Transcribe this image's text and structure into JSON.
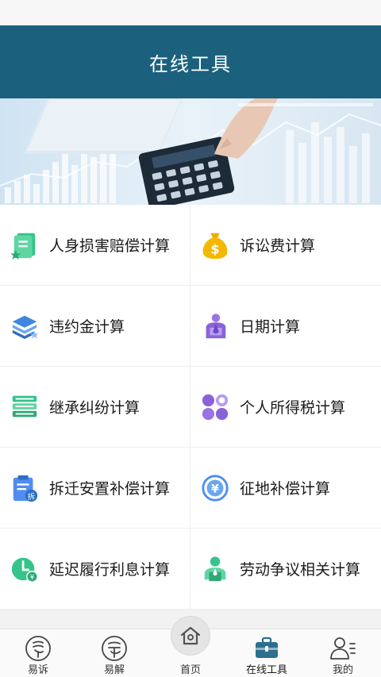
{
  "header": {
    "title": "在线工具"
  },
  "tools": [
    {
      "label": "人身损害赔偿计算",
      "icon": "notebook-icon"
    },
    {
      "label": "诉讼费计算",
      "icon": "money-bag-icon"
    },
    {
      "label": "违约金计算",
      "icon": "layers-icon"
    },
    {
      "label": "日期计算",
      "icon": "person-icon"
    },
    {
      "label": "继承纠纷计算",
      "icon": "books-icon"
    },
    {
      "label": "个人所得税计算",
      "icon": "apps-grid-icon"
    },
    {
      "label": "拆迁安置补偿计算",
      "icon": "clipboard-icon"
    },
    {
      "label": "征地补偿计算",
      "icon": "yuan-coin-icon"
    },
    {
      "label": "延迟履行利息计算",
      "icon": "clock-yuan-icon"
    },
    {
      "label": "劳动争议相关计算",
      "icon": "worker-icon"
    }
  ],
  "tabbar": {
    "items": [
      {
        "label": "易诉",
        "icon": "yisu-icon"
      },
      {
        "label": "易解",
        "icon": "yijie-icon"
      },
      {
        "label": "首页",
        "icon": "home-icon"
      },
      {
        "label": "在线工具",
        "icon": "toolbox-icon",
        "active": true
      },
      {
        "label": "我的",
        "icon": "profile-icon"
      }
    ]
  },
  "colors": {
    "header": "#1b617d",
    "accent": "#2c6f8e",
    "green": "#35c48a",
    "purple": "#8a62d8",
    "blue": "#4f8ef0",
    "gold": "#f5b800"
  }
}
